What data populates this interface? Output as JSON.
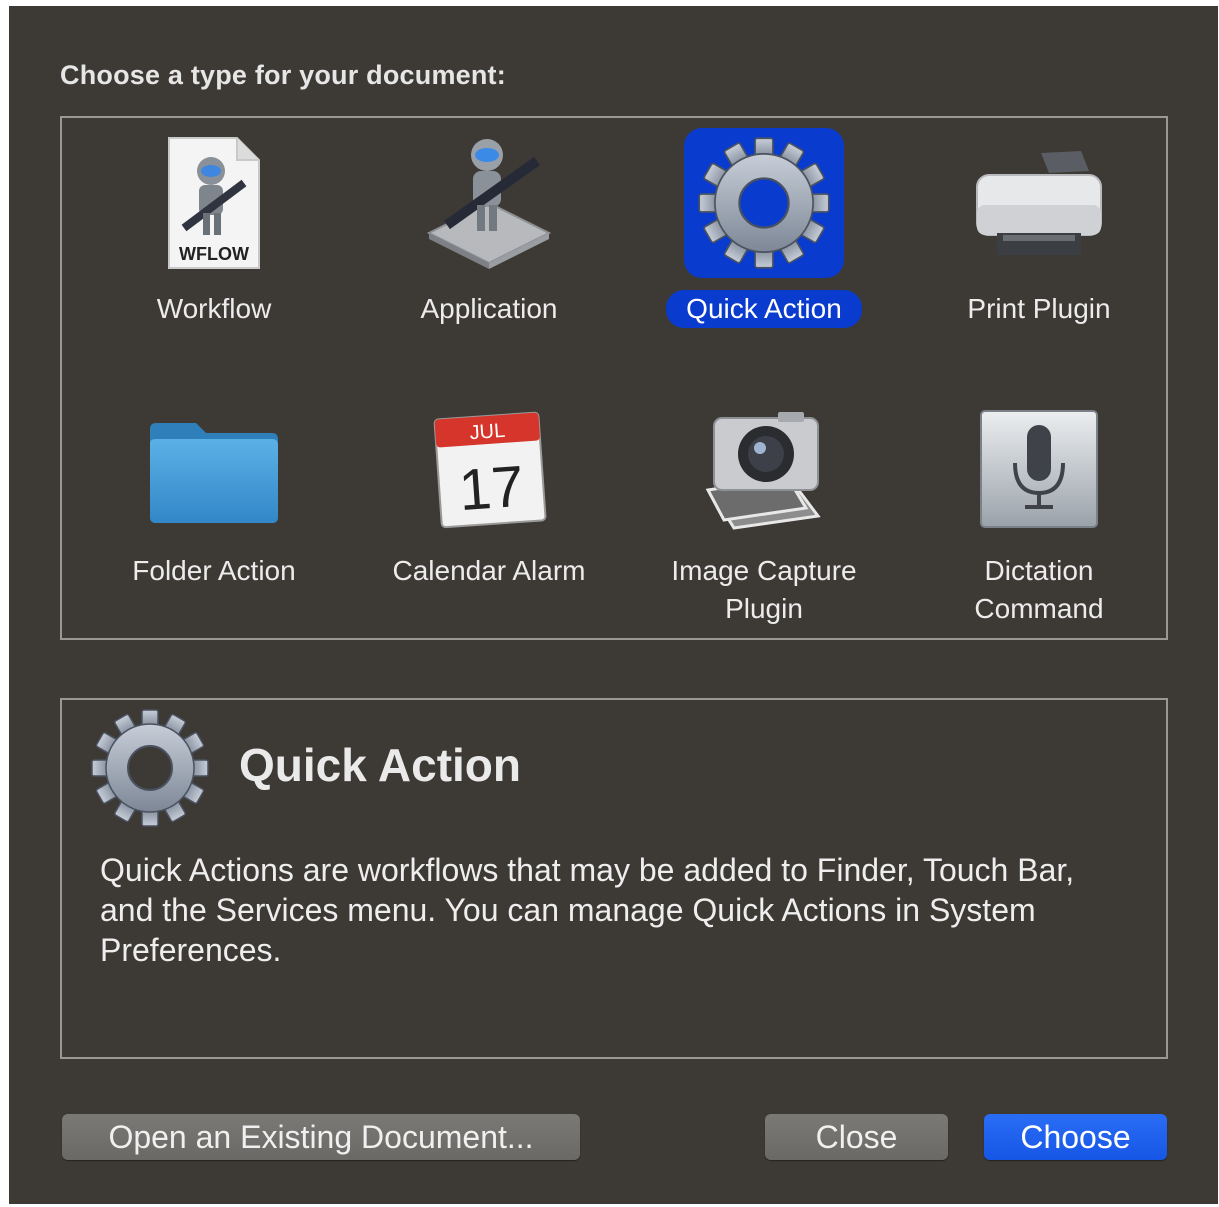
{
  "dialog": {
    "prompt": "Choose a type for your document:",
    "types": [
      {
        "label": "Workflow",
        "icon": "workflow-document-icon",
        "badge": "WFLOW"
      },
      {
        "label": "Application",
        "icon": "automator-robot-icon"
      },
      {
        "label": "Quick Action",
        "icon": "gear-icon",
        "selected": true
      },
      {
        "label": "Print Plugin",
        "icon": "printer-icon"
      },
      {
        "label": "Folder Action",
        "icon": "folder-icon"
      },
      {
        "label": "Calendar Alarm",
        "icon": "calendar-icon",
        "month": "JUL",
        "day": "17"
      },
      {
        "label_line1": "Image Capture",
        "label_line2": "Plugin",
        "icon": "camera-icon"
      },
      {
        "label_line1": "Dictation",
        "label_line2": "Command",
        "icon": "microphone-icon"
      }
    ],
    "description": {
      "icon": "gear-icon",
      "title": "Quick Action",
      "text": "Quick Actions are workflows that may be added to Finder, Touch Bar, and the Services menu. You can manage Quick Actions in System Preferences."
    },
    "buttons": {
      "open_existing": "Open an Existing Document...",
      "close": "Close",
      "choose": "Choose"
    },
    "colors": {
      "background": "#3d3935",
      "selection": "#0a3bcf",
      "default_button": "#1656e6",
      "folder": "#3f9bd6",
      "calendar_red": "#d6352b"
    }
  }
}
